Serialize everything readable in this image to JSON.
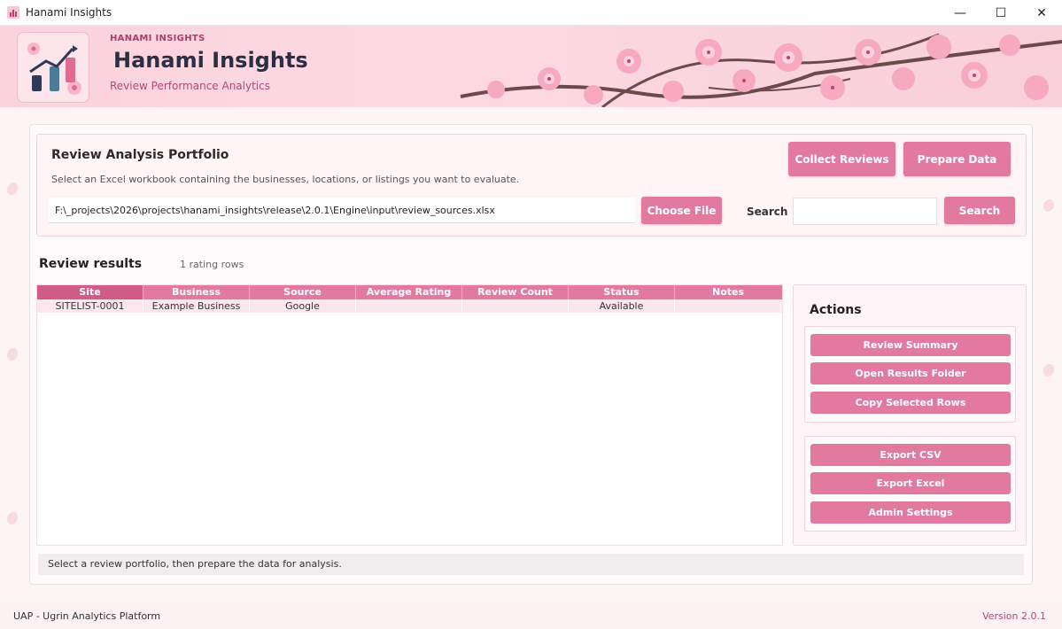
{
  "window": {
    "title": "Hanami Insights",
    "controls": {
      "minimize": "—",
      "maximize": "☐",
      "close": "✕"
    }
  },
  "header": {
    "kicker": "HANAMI INSIGHTS",
    "title": "Hanami Insights",
    "subtitle": "Review Performance Analytics"
  },
  "portfolio": {
    "title": "Review Analysis Portfolio",
    "description": "Select an Excel workbook containing the businesses, locations, or listings you want to evaluate.",
    "file_path": "F:\\_projects\\2026\\projects\\hanami_insights\\release\\2.0.1\\Engine\\input\\review_sources.xlsx",
    "choose_file_label": "Choose File",
    "search_label": "Search",
    "search_value": "",
    "search_button_label": "Search",
    "collect_reviews_label": "Collect Reviews",
    "prepare_data_label": "Prepare Data"
  },
  "results": {
    "title": "Review results",
    "count": "1 rating rows",
    "columns": [
      "Site",
      "Business",
      "Source",
      "Average Rating",
      "Review Count",
      "Status",
      "Notes"
    ],
    "rows": [
      [
        "SITELIST-0001",
        "Example Business",
        "Google",
        "",
        "",
        "Available",
        ""
      ]
    ]
  },
  "actions": {
    "title": "Actions",
    "group1": [
      "Review Summary",
      "Open Results Folder",
      "Copy Selected Rows"
    ],
    "group2": [
      "Export CSV",
      "Export Excel",
      "Admin Settings"
    ]
  },
  "status_message": "Select a review portfolio, then prepare the data for analysis.",
  "footer": {
    "left": "UAP - Ugrin Analytics Platform",
    "right": "Version 2.0.1"
  },
  "colors": {
    "accent": "#e27aa0",
    "accent_dark": "#cf5c86",
    "brand_text": "#b03a6a",
    "title_text": "#2b2f44"
  }
}
